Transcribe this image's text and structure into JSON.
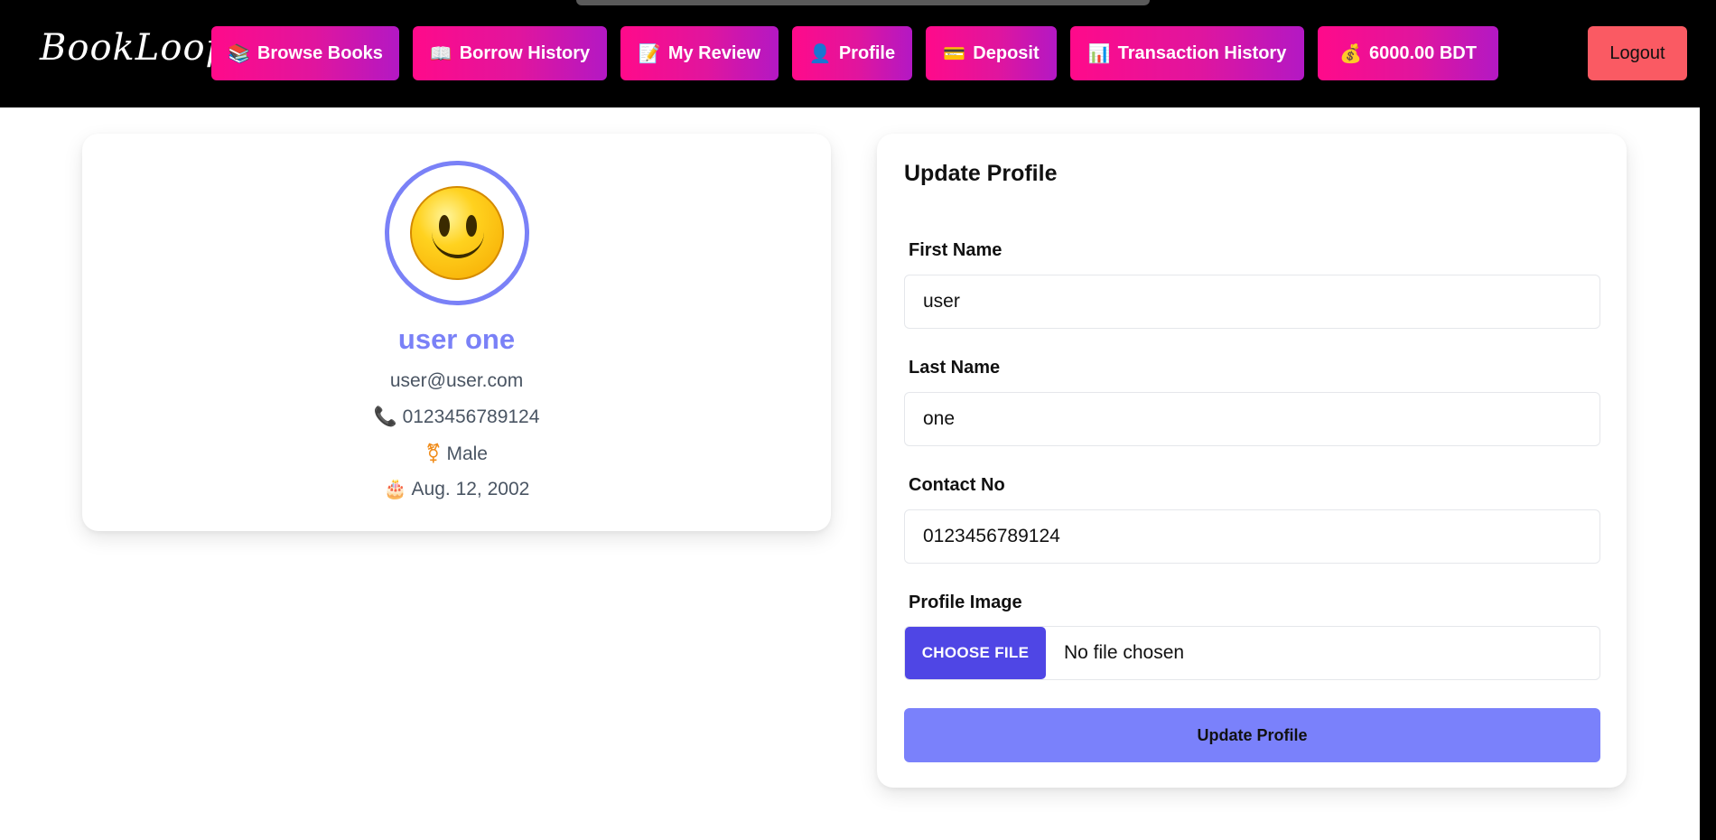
{
  "app": {
    "logo": "BookLoop"
  },
  "nav": {
    "items": [
      {
        "icon": "📚",
        "label": "Browse Books"
      },
      {
        "icon": "📖",
        "label": "Borrow History"
      },
      {
        "icon": "📝",
        "label": "My Review"
      },
      {
        "icon": "👤",
        "label": "Profile"
      },
      {
        "icon": "💳",
        "label": "Deposit"
      },
      {
        "icon": "📊",
        "label": "Transaction History"
      },
      {
        "icon": "💰",
        "label": "6000.00 BDT"
      }
    ],
    "logout": "Logout"
  },
  "profile": {
    "avatar_icon": "smiley-face",
    "name": "user one",
    "email": "user@user.com",
    "phone_icon": "📞",
    "phone": "0123456789124",
    "gender_icon": "⚧",
    "gender": "Male",
    "dob_icon": "🎂",
    "dob": "Aug. 12, 2002"
  },
  "form": {
    "title": "Update Profile",
    "first_name": {
      "label": "First Name",
      "value": "user"
    },
    "last_name": {
      "label": "Last Name",
      "value": "one"
    },
    "contact": {
      "label": "Contact No",
      "value": "0123456789124"
    },
    "image": {
      "label": "Profile Image",
      "button": "CHOOSE FILE",
      "status": "No file chosen"
    },
    "submit": "Update Profile"
  },
  "colors": {
    "nav_gradient_start": "#ff0a8a",
    "nav_gradient_end": "#b318c4",
    "accent": "#7a81f7",
    "file_button": "#4f46e5",
    "logout": "#fa5a63"
  }
}
